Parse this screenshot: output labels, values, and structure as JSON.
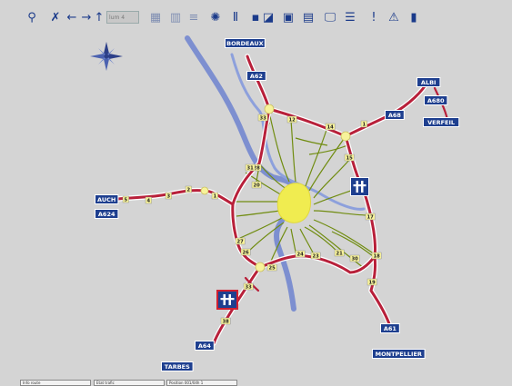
{
  "toolbar": {
    "zoom_field_value": "lum 4",
    "buttons": [
      {
        "name": "road-person-icon",
        "glyph": "⚲"
      },
      {
        "name": "select-tool-icon",
        "glyph": "✗"
      },
      {
        "name": "arrow-left-icon",
        "glyph": "←"
      },
      {
        "name": "arrow-right-icon",
        "glyph": "→"
      },
      {
        "name": "arrow-up-icon",
        "glyph": "↑"
      },
      {
        "name": "layer-toggle-icon",
        "glyph": "▭"
      },
      {
        "name": "grid-view-icon",
        "glyph": "▦"
      },
      {
        "name": "panel-view-icon",
        "glyph": "▥"
      },
      {
        "name": "lines-view-icon",
        "glyph": "≡"
      },
      {
        "name": "weather-icon",
        "glyph": "✺"
      },
      {
        "name": "motorway-icon",
        "glyph": "Ⅱ"
      },
      {
        "name": "small-square-icon",
        "glyph": "▪"
      },
      {
        "name": "camera-icon",
        "glyph": "◪"
      },
      {
        "name": "screen-icon",
        "glyph": "▣"
      },
      {
        "name": "news-icon",
        "glyph": "▤"
      },
      {
        "name": "computer-icon",
        "glyph": "🖵"
      },
      {
        "name": "list-icon",
        "glyph": "☰"
      },
      {
        "name": "alert-sign-icon",
        "glyph": "!"
      },
      {
        "name": "warning-icon",
        "glyph": "⚠"
      },
      {
        "name": "statistics-icon",
        "glyph": "▮"
      }
    ]
  },
  "map": {
    "colors": {
      "background": "#d4d4d4",
      "motorway": "#b8203a",
      "motorway_edge": "#ffffff",
      "river": "#7d8fd0",
      "local_roads": "#708c10",
      "city_center": "#f0ec50",
      "sign_bg": "#1e3f8f",
      "exit_bg": "#f7f29a"
    },
    "compass_icon": "compass-rose-icon",
    "place_signs": [
      {
        "id": "bordeaux",
        "label": "BORDEAUX"
      },
      {
        "id": "a62",
        "label": "A62"
      },
      {
        "id": "albi",
        "label": "ALBI"
      },
      {
        "id": "a680",
        "label": "A680"
      },
      {
        "id": "a68",
        "label": "A68"
      },
      {
        "id": "verfeil",
        "label": "VERFEIL"
      },
      {
        "id": "auch",
        "label": "AUCH"
      },
      {
        "id": "a624",
        "label": "A624"
      },
      {
        "id": "a61",
        "label": "A61"
      },
      {
        "id": "montpellier",
        "label": "MONTPELLIER"
      },
      {
        "id": "a64",
        "label": "A64"
      },
      {
        "id": "tarbes",
        "label": "TARBES"
      }
    ],
    "exit_labels": [
      "33",
      "12",
      "14",
      "1",
      "15",
      "17",
      "18",
      "19",
      "20",
      "21",
      "23",
      "24",
      "25",
      "26",
      "27",
      "28",
      "30",
      "31",
      "33",
      "38",
      "1",
      "2",
      "3",
      "4",
      "5"
    ]
  },
  "statusbar": {
    "fields": [
      "Info route",
      "Etat trafic",
      "Position 001/04h 1"
    ]
  }
}
